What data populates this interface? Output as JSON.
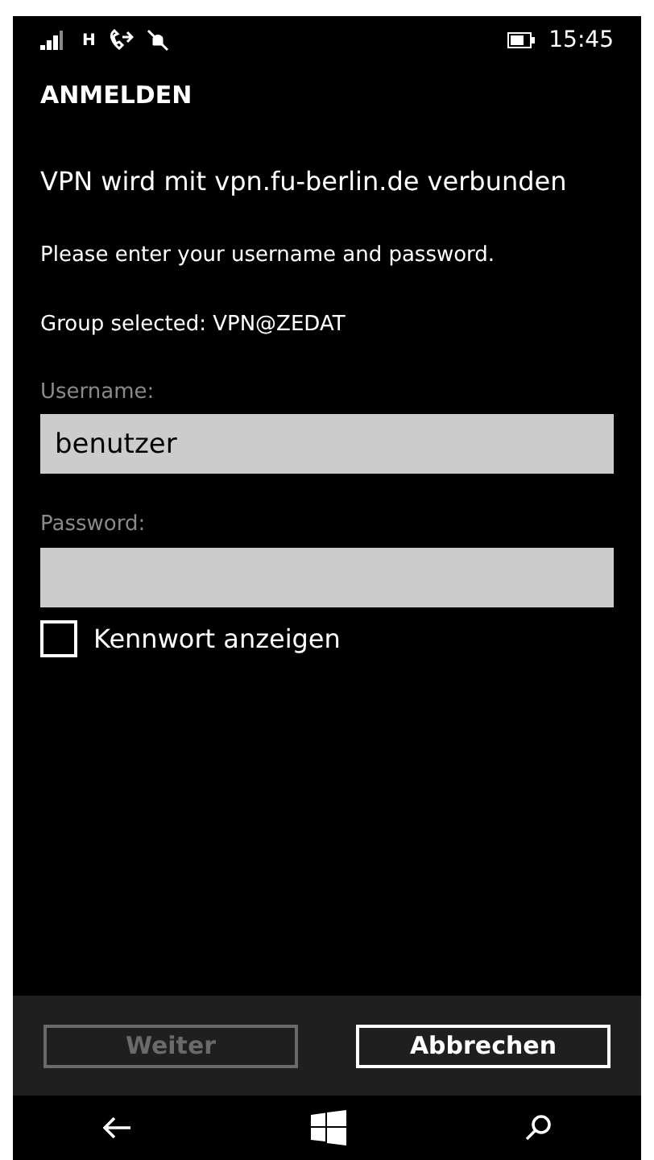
{
  "status_bar": {
    "network": "H",
    "time": "15:45"
  },
  "title": "ANMELDEN",
  "heading": "VPN wird mit vpn.fu-berlin.de verbunden",
  "instruction": "Please enter your username and password.",
  "group": "Group selected: VPN@ZEDAT",
  "fields": [
    {
      "label": "Username:",
      "value": "benutzer"
    },
    {
      "label": "Password:"
    }
  ],
  "show_password": {
    "label": "Kennwort anzeigen",
    "checked": false
  },
  "buttons": [
    {
      "label": "Weiter",
      "disabled": true
    },
    {
      "label": "Abbrechen",
      "disabled": false
    }
  ]
}
